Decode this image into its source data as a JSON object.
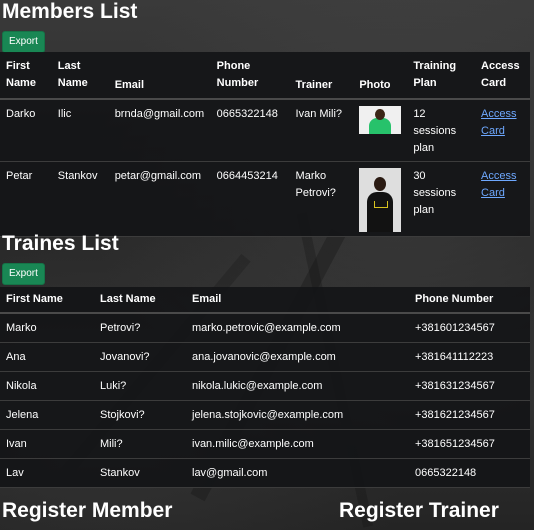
{
  "members": {
    "title": "Members List",
    "export_label": "Export",
    "columns": [
      "First Name",
      "Last Name",
      "Email",
      "Phone Number",
      "Trainer",
      "Photo",
      "Training Plan",
      "Access Card"
    ],
    "rows": [
      {
        "first": "Darko",
        "last": "Ilic",
        "email": "brnda@gmail.com",
        "phone": "0665322148",
        "trainer": "Ivan Mili?",
        "plan": "12 sessions plan",
        "card": "Access Card"
      },
      {
        "first": "Petar",
        "last": "Stankov",
        "email": "petar@gmail.com",
        "phone": "0664453214",
        "trainer": "Marko Petrovi?",
        "plan": "30 sessions plan",
        "card": "Access Card"
      }
    ]
  },
  "trainers": {
    "title": "Traines List",
    "export_label": "Export",
    "columns": [
      "First Name",
      "Last Name",
      "Email",
      "Phone Number"
    ],
    "rows": [
      {
        "first": "Marko",
        "last": "Petrovi?",
        "email": "marko.petrovic@example.com",
        "phone": "+381601234567"
      },
      {
        "first": "Ana",
        "last": "Jovanovi?",
        "email": "ana.jovanovic@example.com",
        "phone": "+381641112223"
      },
      {
        "first": "Nikola",
        "last": "Luki?",
        "email": "nikola.lukic@example.com",
        "phone": "+381631234567"
      },
      {
        "first": "Jelena",
        "last": "Stojkovi?",
        "email": "jelena.stojkovic@example.com",
        "phone": "+381621234567"
      },
      {
        "first": "Ivan",
        "last": "Mili?",
        "email": "ivan.milic@example.com",
        "phone": "+381651234567"
      },
      {
        "first": "Lav",
        "last": "Stankov",
        "email": "lav@gmail.com",
        "phone": "0665322148"
      }
    ]
  },
  "register": {
    "member_title": "Register Member",
    "trainer_title": "Register Trainer"
  },
  "colors": {
    "export_button": "#198754",
    "link": "#6ea8fe",
    "table_bg": "#141517"
  }
}
